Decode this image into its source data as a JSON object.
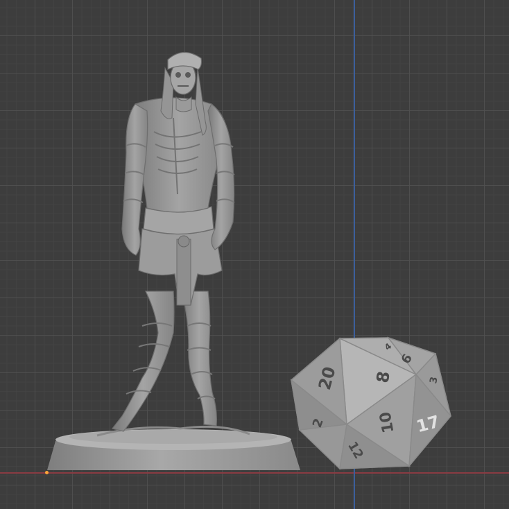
{
  "viewport": {
    "colors": {
      "background": "#3d3d3d",
      "grid_major": "#505050",
      "grid_minor": "#464646",
      "x_axis": "#8a3b42",
      "y_axis": "#3b5f9c",
      "origin": "#ffa43a",
      "model": "#9e9e9e"
    }
  },
  "scene": {
    "objects": [
      {
        "name": "mummy-miniature",
        "type": "figurine-on-round-base"
      },
      {
        "name": "d20-die",
        "type": "icosahedron"
      }
    ],
    "die_faces": {
      "top_left": "20",
      "center": "8",
      "top_right": "6",
      "top_small": "4",
      "right_top": "3",
      "right": "17",
      "center_right": "10",
      "bottom": "12",
      "left": "2"
    }
  }
}
